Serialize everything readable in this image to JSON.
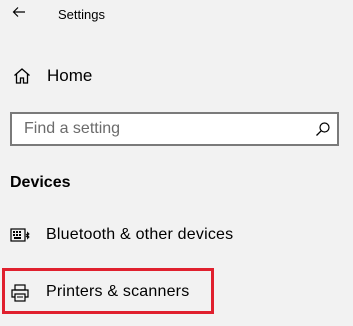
{
  "window": {
    "title": "Settings",
    "back_icon": "back-arrow-icon"
  },
  "nav": {
    "home": {
      "label": "Home",
      "icon": "home-icon"
    }
  },
  "search": {
    "placeholder": "Find a setting",
    "icon": "search-icon"
  },
  "section": {
    "heading": "Devices",
    "items": [
      {
        "label": "Bluetooth & other devices",
        "icon": "keyboard-bluetooth-icon",
        "selected": false
      },
      {
        "label": "Printers & scanners",
        "icon": "printer-icon",
        "selected": true
      }
    ]
  },
  "colors": {
    "background": "#f2f2f2",
    "highlight_border": "#e0202e",
    "search_border": "#7a7a7a",
    "placeholder_text": "#6b6b6b"
  }
}
